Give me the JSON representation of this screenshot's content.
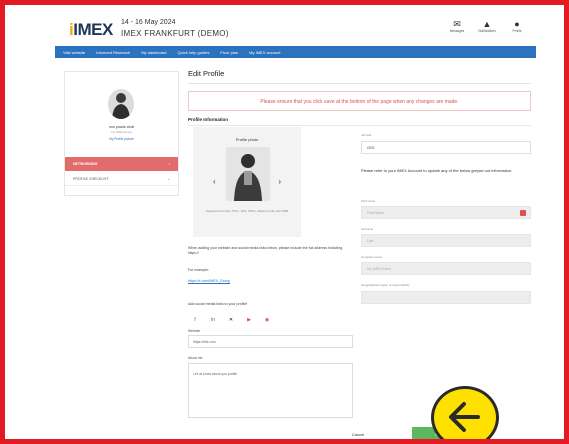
{
  "header": {
    "logo_text": "IMEX",
    "event_dates": "14 - 16 May 2024",
    "event_name": "IMEX FRANKFURT (DEMO)",
    "icons": [
      {
        "icon": "messages-icon",
        "label": "Messages"
      },
      {
        "icon": "notifications-icon",
        "label": "Notifications"
      },
      {
        "icon": "profile-icon",
        "label": "Profile"
      }
    ]
  },
  "nav": {
    "items": [
      "Visit website",
      "Informed Research",
      "My dashboard",
      "Quick help guides",
      "Floor plan",
      "My IMEX account"
    ]
  },
  "sidebar": {
    "name": "xxx pacis club",
    "subtitle": "xxx IMEX Event",
    "profile_link": "My Profile picture",
    "active_item": "NETWORKING",
    "item": "PROFILE CHECKLIST"
  },
  "main": {
    "title": "Edit Profile",
    "notice": "Please ensure that you click save at the bottom of the page when any changes are made.",
    "section_title": "Profile Information",
    "photo_label": "Profile photo",
    "photo_hint": "Supported formats: PNG, JPG, JPEG. Maximum file size 5MB",
    "website_help": "When adding your website and social media links below, please include the full address including https://",
    "website_help_link": "https://",
    "example_label": "For example:",
    "example_url": "https://x.com/IMEX_Group",
    "social_title": "Add social media links to your profile!",
    "website_label": "Website",
    "website_placeholder": "https://link.com",
    "about_label": "About me",
    "about_placeholder": "Let us know about you profile"
  },
  "right": {
    "job_title_label": "Job title",
    "job_title_value": "CEO",
    "info_text": "Please refer to your IMEX Account to update any of the below greyed out information.",
    "first_name_label": "First name",
    "first_name_value": "First Name",
    "surname_label": "Surname",
    "surname_value": "Last",
    "company_label": "Company name",
    "company_value": "xxx IMEX Event",
    "region_label": "Geographical region of responsibility",
    "region_value": ""
  },
  "actions": {
    "cancel": "Cancel",
    "save": "Save"
  },
  "colors": {
    "frame": "#e21b22",
    "nav": "#2b72bf",
    "accent_red": "#d9534f",
    "save_green": "#5cb85c",
    "indicator": "#ffe100"
  }
}
